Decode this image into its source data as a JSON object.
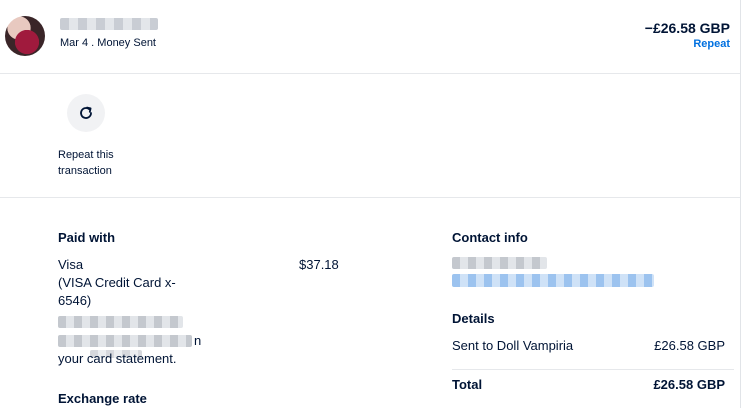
{
  "header": {
    "date_status": "Mar 4 . Money Sent",
    "amount": "−£26.58 GBP",
    "repeat_link": "Repeat"
  },
  "repeat": {
    "label": "Repeat this transaction",
    "icon": "refresh-icon"
  },
  "paid_with": {
    "title": "Paid with",
    "method": "Visa",
    "card_line1": "(VISA Credit Card x-",
    "card_line2": "6546)",
    "amount": "$37.18",
    "note_line1_end": "n",
    "note_line2": "your card statement."
  },
  "exchange_rate": {
    "title": "Exchange rate"
  },
  "contact": {
    "title": "Contact info"
  },
  "details": {
    "title": "Details",
    "sent_to_label": "Sent to Doll Vampiria",
    "sent_to_amount": "£26.58 GBP",
    "total_label": "Total",
    "total_amount": "£26.58 GBP"
  },
  "colors": {
    "text": "#001435",
    "link": "#0070e0",
    "divider": "#e6e8eb"
  }
}
